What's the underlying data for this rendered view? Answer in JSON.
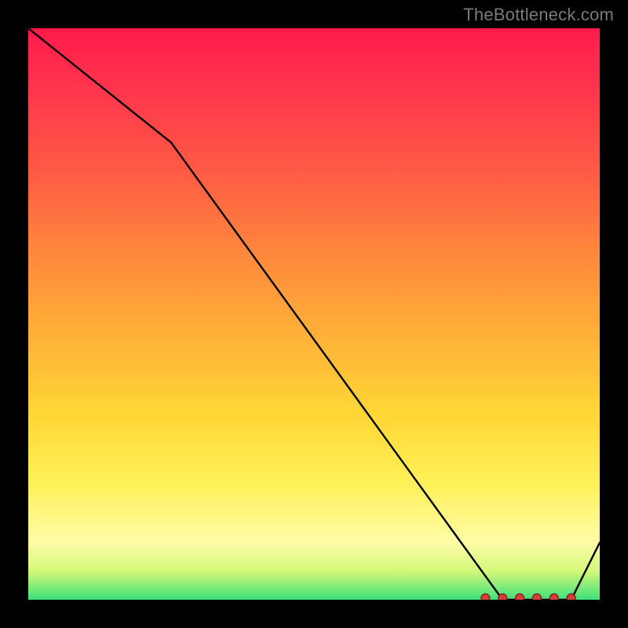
{
  "watermark": "TheBottleneck.com",
  "chart_data": {
    "type": "line",
    "title": "",
    "xlabel": "",
    "ylabel": "",
    "xlim": [
      0,
      100
    ],
    "ylim": [
      0,
      100
    ],
    "grid": false,
    "legend": false,
    "series": [
      {
        "name": "curve",
        "x": [
          0,
          25,
          83,
          95,
          100
        ],
        "values": [
          100,
          80,
          0,
          0,
          10
        ]
      }
    ],
    "markers": {
      "name": "bottom-cluster",
      "x": [
        80,
        83,
        86,
        89,
        92,
        95
      ],
      "values": [
        0,
        0,
        0,
        0,
        0,
        0
      ]
    },
    "colors": {
      "line": "#000000",
      "marker_fill": "#d43f3a",
      "marker_stroke": "#8a1f1c"
    }
  }
}
